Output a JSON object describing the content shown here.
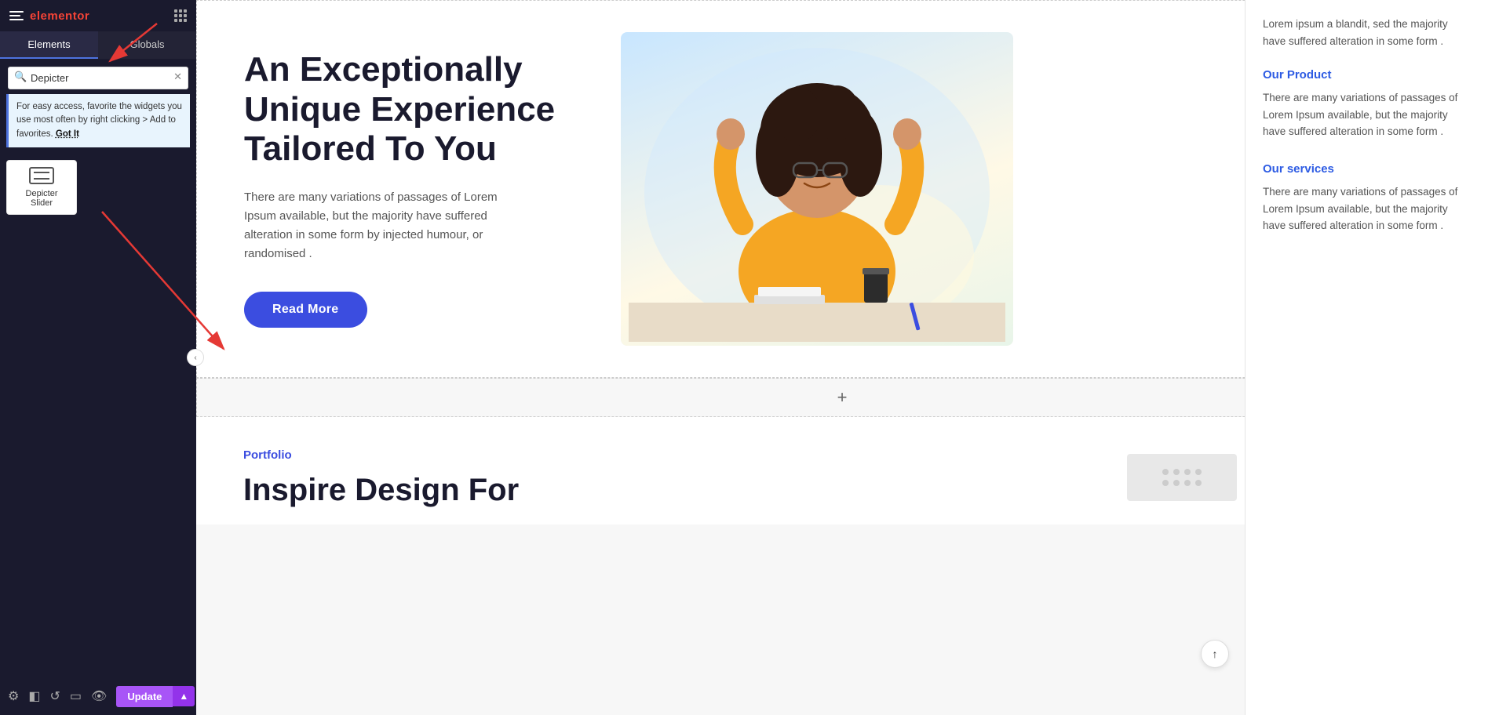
{
  "sidebar": {
    "logo_text": "elementor",
    "tabs": [
      {
        "label": "Elements",
        "active": true
      },
      {
        "label": "Globals",
        "active": false
      }
    ],
    "search": {
      "value": "Depicter",
      "placeholder": "Search..."
    },
    "hint": {
      "text": "For easy access, favorite the widgets you use most often by right clicking > Add to favorites.",
      "got_it": "Got It"
    },
    "widgets": [
      {
        "label": "Depicter Slider",
        "icon": "slider-icon"
      }
    ]
  },
  "toolbar": {
    "icons": [
      "settings-icon",
      "layers-icon",
      "history-icon",
      "responsive-icon",
      "preview-icon"
    ],
    "update_label": "Update",
    "caret_label": "▲"
  },
  "hero": {
    "title": "An Exceptionally Unique Experience Tailored To You",
    "description": "There are many variations of passages of Lorem Ipsum available, but the majority have suffered alteration in some form by injected humour, or randomised .",
    "button_label": "Read More"
  },
  "right_panel": {
    "intro_text": "Lorem ipsum a blandit, sed the majority have suffered alteration in some form .",
    "sections": [
      {
        "title": "Our Product",
        "text": "There are many variations of passages of Lorem Ipsum available, but the majority have suffered alteration in some form ."
      },
      {
        "title": "Our services",
        "text": "There are many variations of passages of Lorem Ipsum available, but the majority have suffered alteration in some form ."
      }
    ]
  },
  "add_section": {
    "plus_label": "+"
  },
  "portfolio": {
    "label": "Portfolio",
    "title": "Inspire Design For"
  },
  "scroll_top": {
    "icon": "chevron-up-icon"
  }
}
